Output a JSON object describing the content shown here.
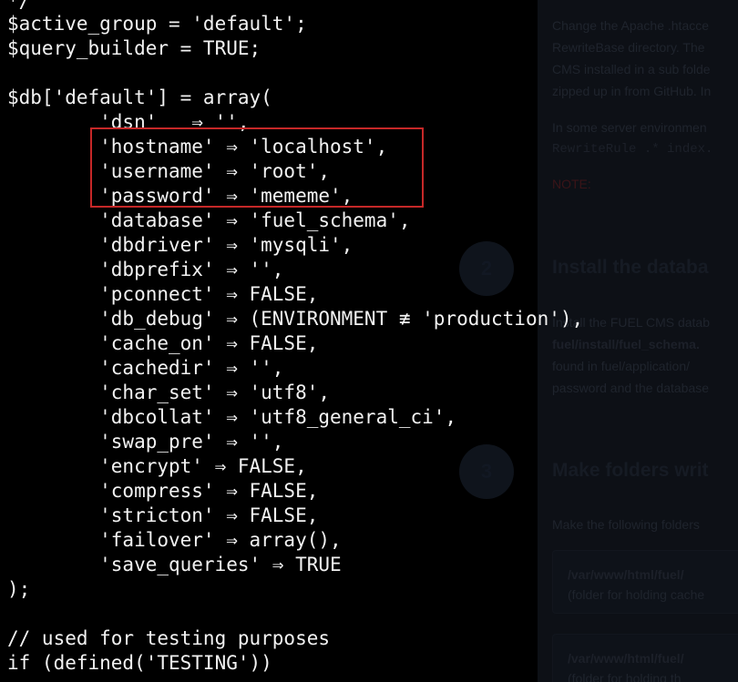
{
  "background_page": {
    "paragraph1": [
      "Change the Apache .htacce",
      "RewriteBase directory. The",
      "CMS installed in a sub folde",
      "zipped up in from GitHub. In"
    ],
    "paragraph2": [
      "In some server environmen",
      "RewriteRule .* index."
    ],
    "note": "NOTE:",
    "step2": {
      "number": "2",
      "title": "Install the databa",
      "body": [
        "Install the FUEL CMS datab",
        "fuel/install/fuel_schema.",
        "found in fuel/application/",
        "password and the database"
      ]
    },
    "step3": {
      "number": "3",
      "title": "Make folders writ",
      "intro": "Make the following folders",
      "boxes": [
        {
          "path": "/var/www/html/fuel/",
          "desc": "(folder for holding cache"
        },
        {
          "path": "/var/www/html/fuel/",
          "desc": "(folder for holding th"
        }
      ]
    }
  },
  "code": {
    "lines": [
      "*/",
      "$active_group = 'default';",
      "$query_builder = TRUE;",
      "",
      "$db['default'] = array(",
      "        'dsn'   ⇒ '',",
      "        'hostname' ⇒ 'localhost',",
      "        'username' ⇒ 'root',",
      "        'password' ⇒ 'mememe',",
      "        'database' ⇒ 'fuel_schema',",
      "        'dbdriver' ⇒ 'mysqli',",
      "        'dbprefix' ⇒ '',",
      "        'pconnect' ⇒ FALSE,",
      "        'db_debug' ⇒ (ENVIRONMENT ≢ 'production'),",
      "        'cache_on' ⇒ FALSE,",
      "        'cachedir' ⇒ '',",
      "        'char_set' ⇒ 'utf8',",
      "        'dbcollat' ⇒ 'utf8_general_ci',",
      "        'swap_pre' ⇒ '',",
      "        'encrypt' ⇒ FALSE,",
      "        'compress' ⇒ FALSE,",
      "        'stricton' ⇒ FALSE,",
      "        'failover' ⇒ array(),",
      "        'save_queries' ⇒ TRUE",
      ");",
      "",
      "// used for testing purposes",
      "if (defined('TESTING'))"
    ]
  },
  "highlight": {
    "color": "#c62828"
  }
}
